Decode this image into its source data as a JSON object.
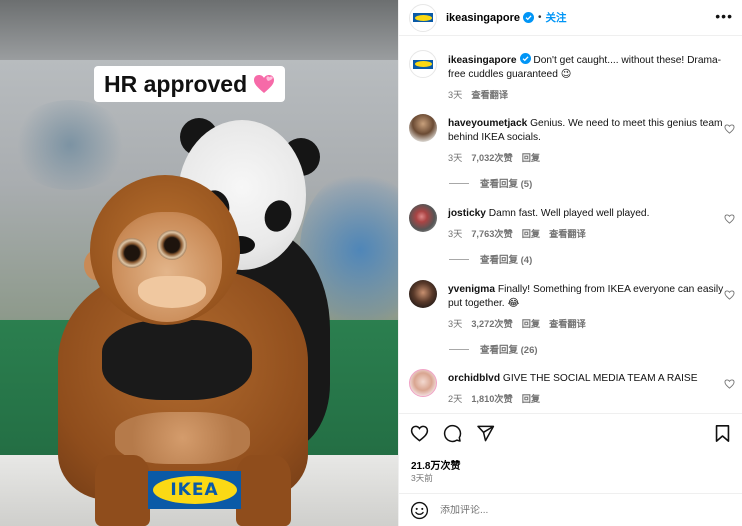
{
  "photo": {
    "caption": "HR approved",
    "caption_emoji": "pink-hearts-emoji",
    "logo_text": "IKEA",
    "colors": {
      "ikea_blue": "#0a5aa7",
      "ikea_yellow": "#fbd914"
    }
  },
  "header": {
    "username": "ikeasingapore",
    "verified": true,
    "separator": "•",
    "follow_label": "关注",
    "more_icon": "more-icon"
  },
  "post": {
    "username": "ikeasingapore",
    "caption": "Don't get caught.... without these! Drama-free cuddles guaranteed 😉",
    "time": "3天",
    "translate_label": "查看翻译"
  },
  "comments": [
    {
      "username": "haveyoumetjack",
      "text": "Genius. We need to meet this genius team behind IKEA socials.",
      "time": "3天",
      "likes": "7,032次赞",
      "reply_label": "回复",
      "replies_label": "查看回复 (5)"
    },
    {
      "username": "josticky",
      "text": "Damn fast. Well played well played.",
      "time": "3天",
      "likes": "7,763次赞",
      "reply_label": "回复",
      "translate_label": "查看翻译",
      "replies_label": "查看回复 (4)"
    },
    {
      "username": "yvenigma",
      "text": "Finally! Something from IKEA everyone can easily put together. 😂",
      "time": "3天",
      "likes": "3,272次赞",
      "reply_label": "回复",
      "translate_label": "查看翻译",
      "replies_label": "查看回复 (26)"
    },
    {
      "username": "orchidblvd",
      "text": "GIVE THE SOCIAL MEDIA TEAM A RAISE",
      "time": "2天",
      "likes": "1,810次赞",
      "reply_label": "回复"
    }
  ],
  "actions": {
    "like_icon": "heart-icon",
    "comment_icon": "comment-icon",
    "share_icon": "share-icon",
    "save_icon": "bookmark-icon",
    "likes_count": "21.8万次赞",
    "posted": "3天前"
  },
  "add_comment": {
    "emoji_icon": "emoji-icon",
    "placeholder": "添加评论..."
  },
  "colors": {
    "link_blue": "#0095f6",
    "secondary_text": "#737373",
    "border": "#efefef"
  }
}
